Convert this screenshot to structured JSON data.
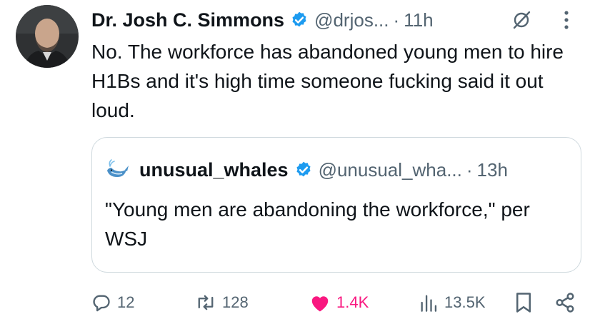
{
  "tweet": {
    "author_name": "Dr. Josh C. Simmons",
    "author_handle": "@drjos...",
    "separator": "·",
    "time": "11h",
    "text": "No. The workforce has abandoned young men to hire H1Bs and it's high time someone fucking said it out loud."
  },
  "quote": {
    "author_name": "unusual_whales",
    "author_handle": "@unusual_wha...",
    "separator": "·",
    "time": "13h",
    "text": "\"Young men are abandoning the workforce,\" per WSJ"
  },
  "actions": {
    "replies": "12",
    "reposts": "128",
    "likes": "1.4K",
    "views": "13.5K"
  },
  "icons": [
    "verified-badge-icon",
    "grok-icon",
    "more-options-icon",
    "whale-icon",
    "reply-icon",
    "repost-icon",
    "like-icon",
    "views-icon",
    "bookmark-icon",
    "share-icon"
  ],
  "colors": {
    "text": "#0f1419",
    "secondary_text": "#536471",
    "verified_blue": "#1d9bf0",
    "like_pink": "#f91880",
    "border": "#cfd9de"
  }
}
